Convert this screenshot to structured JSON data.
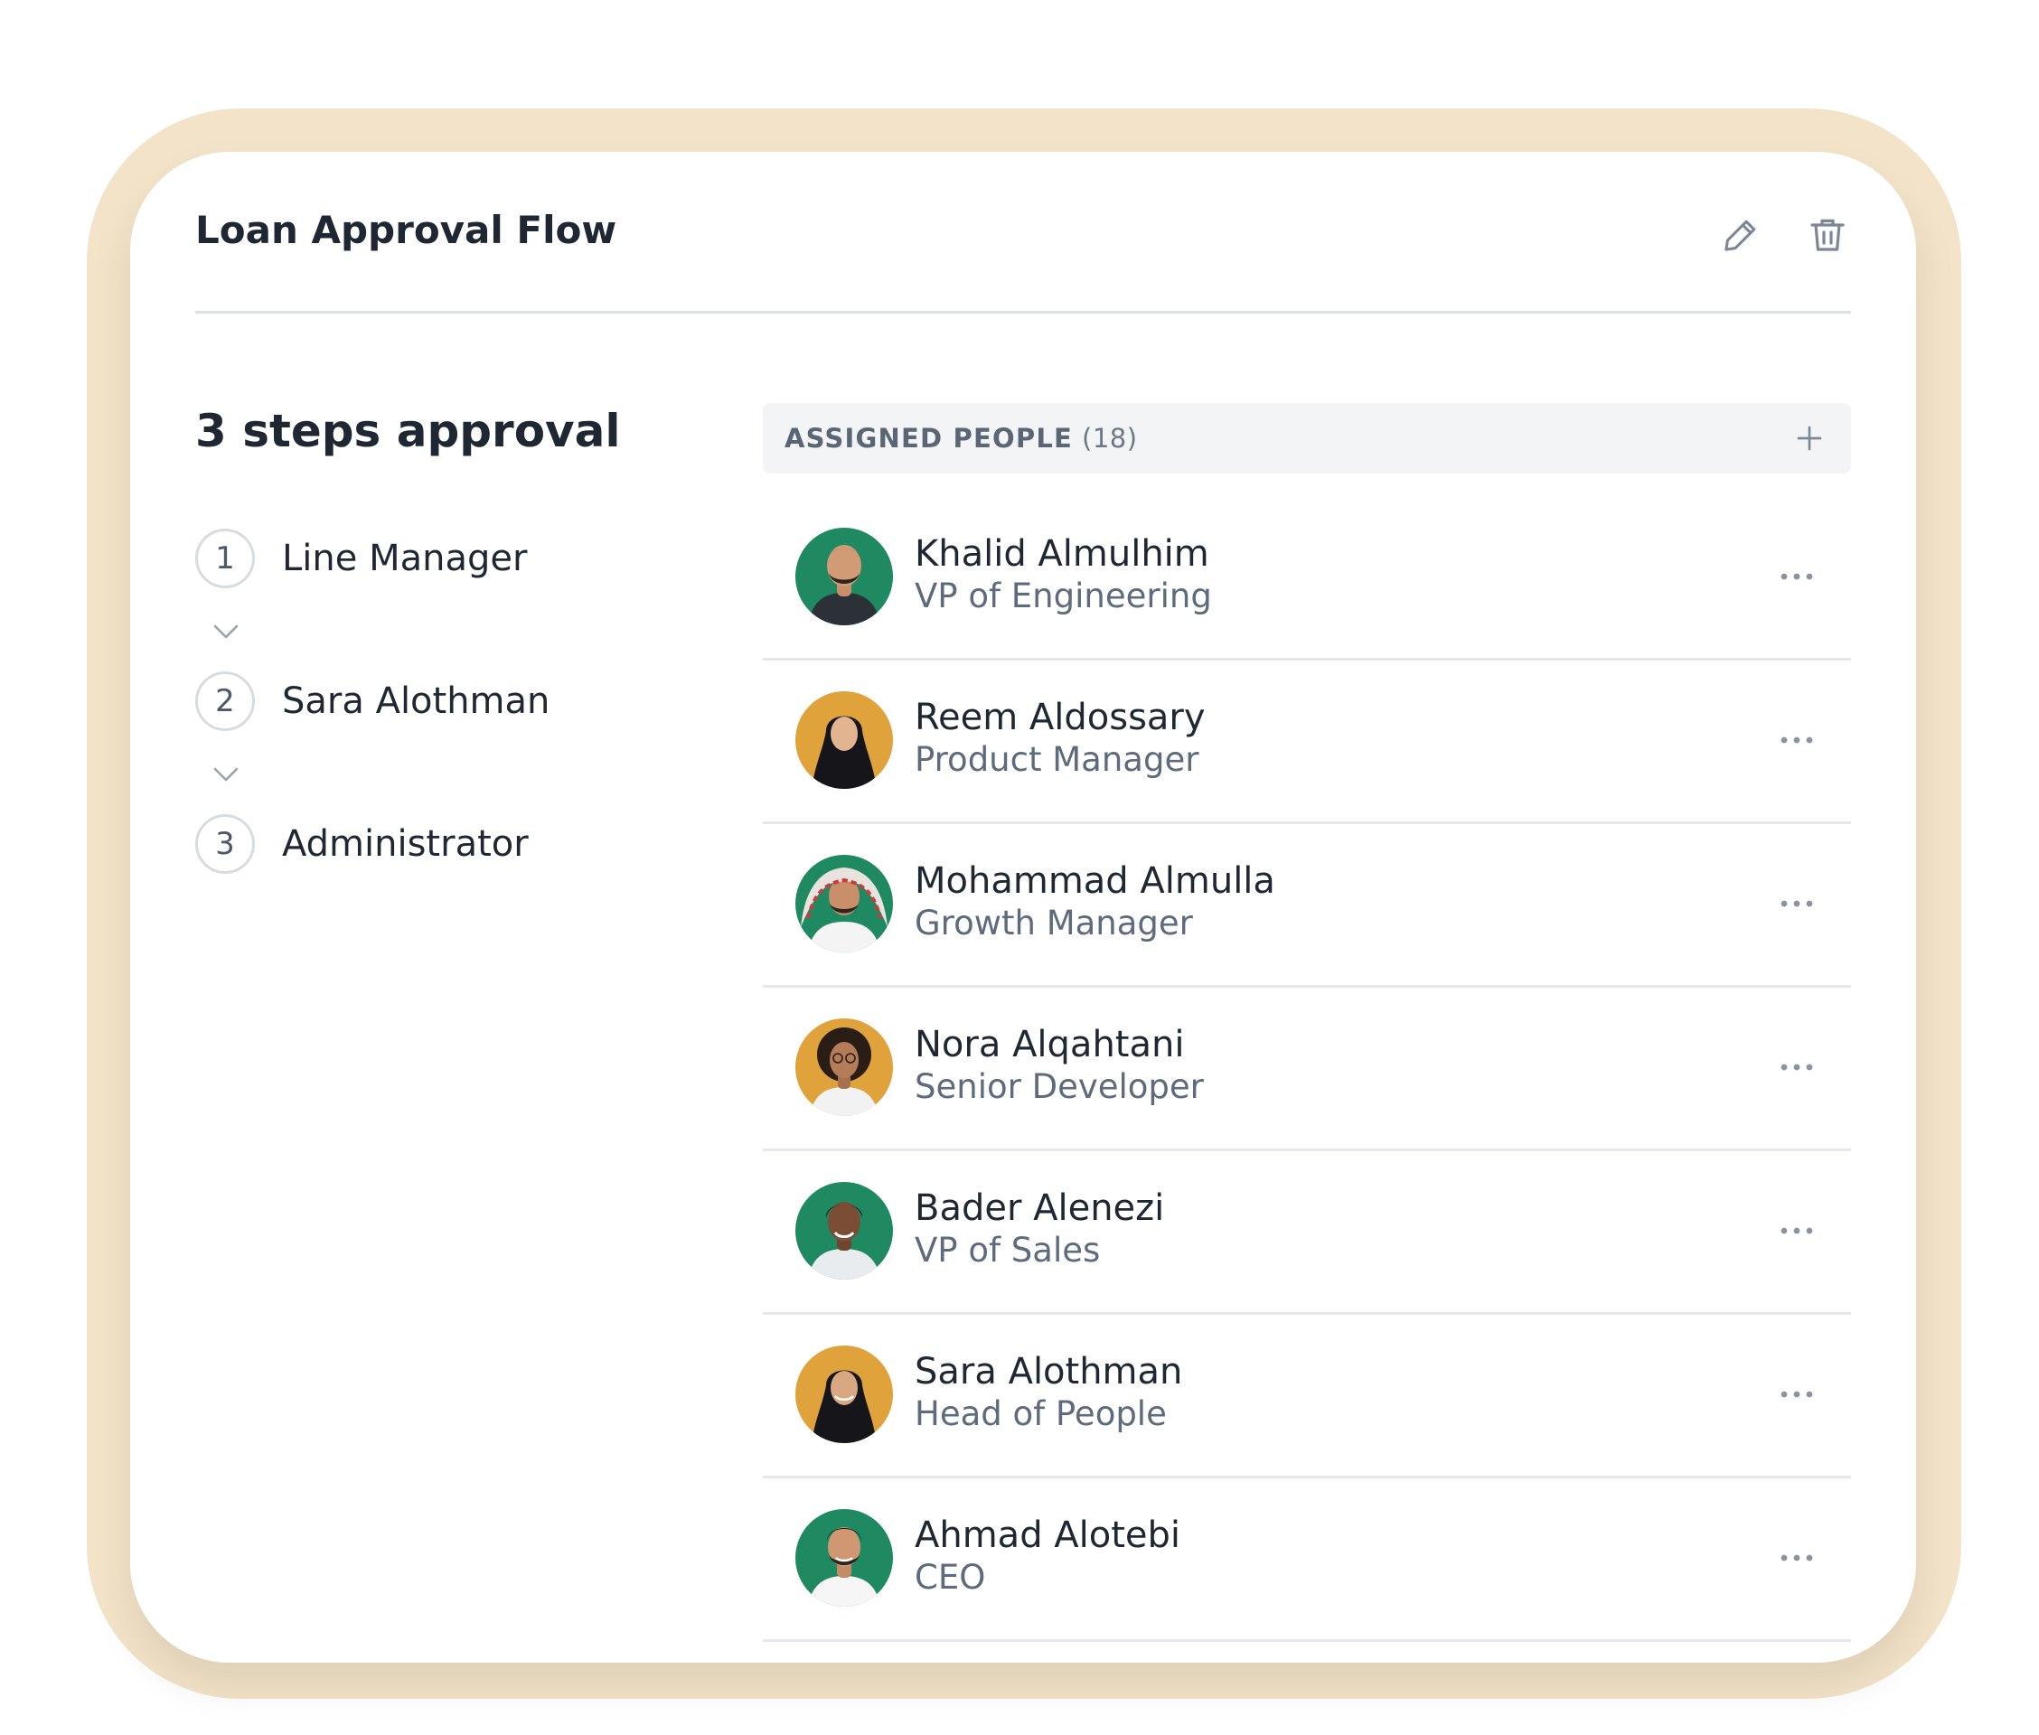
{
  "header": {
    "title": "Loan Approval Flow",
    "edit_icon": "pencil-icon",
    "delete_icon": "trash-icon"
  },
  "approval": {
    "heading": "3 steps approval",
    "steps": [
      {
        "number": "1",
        "label": "Line Manager"
      },
      {
        "number": "2",
        "label": "Sara Alothman"
      },
      {
        "number": "3",
        "label": "Administrator"
      }
    ]
  },
  "assigned": {
    "label": "ASSIGNED PEOPLE",
    "count": "(18)",
    "add_icon": "plus-icon",
    "people": [
      {
        "name": "Khalid Almulhim",
        "role": "VP of Engineering",
        "avatar_bg": "#1f8a61"
      },
      {
        "name": "Reem Aldossary",
        "role": "Product Manager",
        "avatar_bg": "#e0a23a"
      },
      {
        "name": "Mohammad Almulla",
        "role": "Growth Manager",
        "avatar_bg": "#1f8a61"
      },
      {
        "name": "Nora Alqahtani",
        "role": "Senior Developer",
        "avatar_bg": "#e0a23a"
      },
      {
        "name": "Bader Alenezi",
        "role": "VP of Sales",
        "avatar_bg": "#1f8a61"
      },
      {
        "name": "Sara Alothman",
        "role": "Head of People",
        "avatar_bg": "#e0a23a"
      },
      {
        "name": "Ahmad Alotebi",
        "role": "CEO",
        "avatar_bg": "#1f8a61"
      }
    ]
  },
  "colors": {
    "frame": "#f3e3c8",
    "green_avatar": "#1f8a61",
    "amber_avatar": "#e0a23a",
    "text_primary": "#1f2733",
    "text_secondary": "#5d6b7c"
  }
}
